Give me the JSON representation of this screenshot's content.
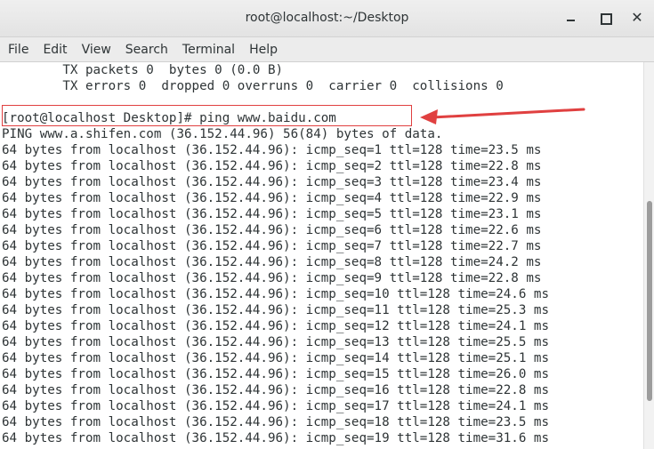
{
  "window": {
    "title": "root@localhost:~/Desktop"
  },
  "menu": [
    "File",
    "Edit",
    "View",
    "Search",
    "Terminal",
    "Help"
  ],
  "terminal": {
    "lines": [
      "        TX packets 0  bytes 0 (0.0 B)",
      "        TX errors 0  dropped 0 overruns 0  carrier 0  collisions 0",
      "",
      "[root@localhost Desktop]# ping www.baidu.com",
      "PING www.a.shifen.com (36.152.44.96) 56(84) bytes of data.",
      "64 bytes from localhost (36.152.44.96): icmp_seq=1 ttl=128 time=23.5 ms",
      "64 bytes from localhost (36.152.44.96): icmp_seq=2 ttl=128 time=22.8 ms",
      "64 bytes from localhost (36.152.44.96): icmp_seq=3 ttl=128 time=23.4 ms",
      "64 bytes from localhost (36.152.44.96): icmp_seq=4 ttl=128 time=22.9 ms",
      "64 bytes from localhost (36.152.44.96): icmp_seq=5 ttl=128 time=23.1 ms",
      "64 bytes from localhost (36.152.44.96): icmp_seq=6 ttl=128 time=22.6 ms",
      "64 bytes from localhost (36.152.44.96): icmp_seq=7 ttl=128 time=22.7 ms",
      "64 bytes from localhost (36.152.44.96): icmp_seq=8 ttl=128 time=24.2 ms",
      "64 bytes from localhost (36.152.44.96): icmp_seq=9 ttl=128 time=22.8 ms",
      "64 bytes from localhost (36.152.44.96): icmp_seq=10 ttl=128 time=24.6 ms",
      "64 bytes from localhost (36.152.44.96): icmp_seq=11 ttl=128 time=25.3 ms",
      "64 bytes from localhost (36.152.44.96): icmp_seq=12 ttl=128 time=24.1 ms",
      "64 bytes from localhost (36.152.44.96): icmp_seq=13 ttl=128 time=25.5 ms",
      "64 bytes from localhost (36.152.44.96): icmp_seq=14 ttl=128 time=25.1 ms",
      "64 bytes from localhost (36.152.44.96): icmp_seq=15 ttl=128 time=26.0 ms",
      "64 bytes from localhost (36.152.44.96): icmp_seq=16 ttl=128 time=22.8 ms",
      "64 bytes from localhost (36.152.44.96): icmp_seq=17 ttl=128 time=24.1 ms",
      "64 bytes from localhost (36.152.44.96): icmp_seq=18 ttl=128 time=23.5 ms",
      "64 bytes from localhost (36.152.44.96): icmp_seq=19 ttl=128 time=31.6 ms"
    ]
  },
  "colors": {
    "annotation": "#e04040",
    "text": "#2e3436"
  },
  "icons": {
    "minimize": "minimize-icon",
    "maximize": "maximize-icon",
    "close": "close-icon"
  }
}
